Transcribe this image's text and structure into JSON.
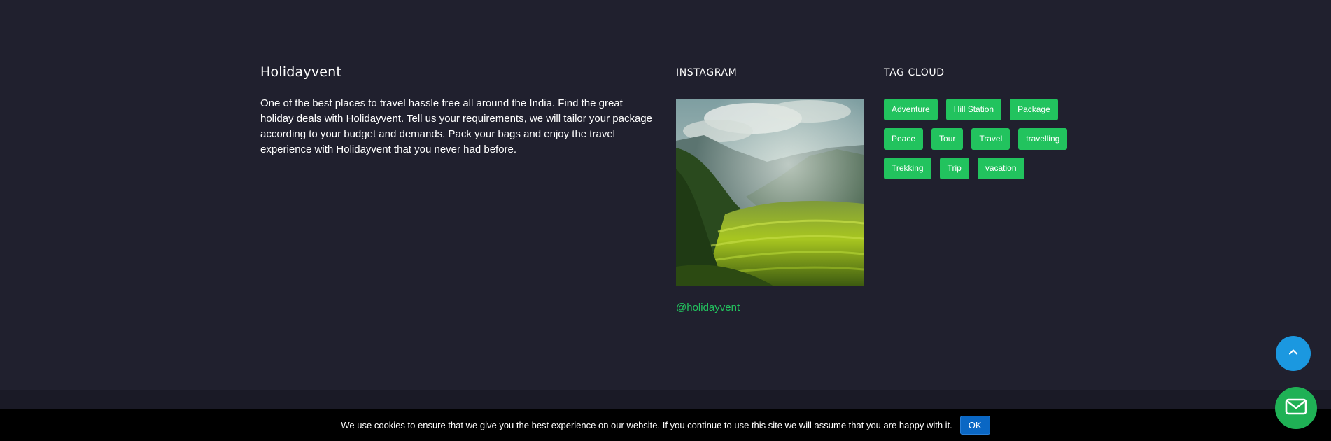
{
  "about": {
    "title": "Holidayvent",
    "description": "One of the best places to travel hassle free all around the India. Find the great holiday deals with Holidayvent. Tell us your requirements, we will tailor your package according to your budget and demands. Pack your bags and enjoy the travel experience with Holidayvent that you never had before."
  },
  "instagram": {
    "title": "INSTAGRAM",
    "handle": "@holidayvent"
  },
  "tag_cloud": {
    "title": "TAG CLOUD",
    "tags": [
      "Adventure",
      "Hill Station",
      "Package",
      "Peace",
      "Tour",
      "Travel",
      "travelling",
      "Trekking",
      "Trip",
      "vacation"
    ]
  },
  "cookie": {
    "text": "We use cookies to ensure that we give you the best experience on our website. If you continue to use this site we will assume that you are happy with it.",
    "ok_label": "OK"
  },
  "floating": {
    "scroll_top_icon": "chevron-up-icon",
    "contact_icon": "mail-icon"
  },
  "colors": {
    "background": "#20202e",
    "accent_green": "#22c35e",
    "scroll_top_blue": "#1b98e0",
    "cookie_ok_blue": "#0a67c4"
  }
}
